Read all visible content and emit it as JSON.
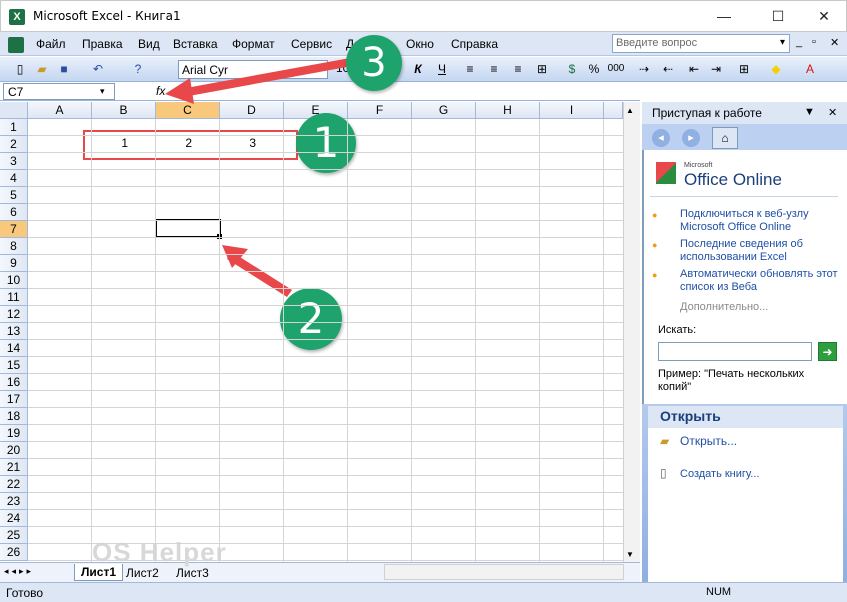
{
  "window": {
    "title": "Microsoft Excel - Книга1",
    "app_icon_text": "X"
  },
  "window_controls": {
    "minimize": "—",
    "maximize": "☐",
    "close": "✕"
  },
  "menu": {
    "items": [
      "Файл",
      "Правка",
      "Вид",
      "Вставка",
      "Формат",
      "Сервис",
      "Данные",
      "Окно",
      "Справка"
    ],
    "ask_placeholder": "Введите вопрос"
  },
  "toolbar": {
    "font_name": "Arial Cyr",
    "font_size": "10",
    "bold": "Ж",
    "italic": "К",
    "underline": "Ч",
    "percent": "%",
    "thousands": "000",
    "fx": "fx"
  },
  "formula_bar": {
    "name_box": "C7",
    "formula": ""
  },
  "columns": [
    "A",
    "B",
    "C",
    "D",
    "E",
    "F",
    "G",
    "H",
    "I"
  ],
  "rows": [
    "1",
    "2",
    "3",
    "4",
    "5",
    "6",
    "7",
    "8",
    "9",
    "10",
    "11",
    "12",
    "13",
    "14",
    "15",
    "16",
    "17",
    "18",
    "19",
    "20",
    "21",
    "22",
    "23",
    "24",
    "25",
    "26"
  ],
  "cells": {
    "B2": "1",
    "C2": "2",
    "D2": "3"
  },
  "selected_cell": "C7",
  "sheets": {
    "tabs": [
      "Лист1",
      "Лист2",
      "Лист3"
    ],
    "active": "Лист1"
  },
  "status": {
    "left": "Готово",
    "num": "NUM"
  },
  "task_pane": {
    "title": "Приступая к работе",
    "logo_small": "Microsoft",
    "logo": "Office Online",
    "links": [
      "Подключиться к веб-узлу Microsoft Office Online",
      "Последние сведения об использовании Excel",
      "Автоматически обновлять этот список из Веба"
    ],
    "more": "Дополнительно...",
    "search_label": "Искать:",
    "example": "Пример: \"Печать нескольких копий\"",
    "open_header": "Открыть",
    "open_link": "Открыть...",
    "create_link": "Создать книгу..."
  },
  "annotations": {
    "one": "1",
    "two": "2",
    "three": "3"
  },
  "watermark": "OS Helper",
  "colors": {
    "accent_green": "#1fa36d",
    "arrow_red": "#e8484a",
    "selection_orange": "#f8c87c"
  }
}
